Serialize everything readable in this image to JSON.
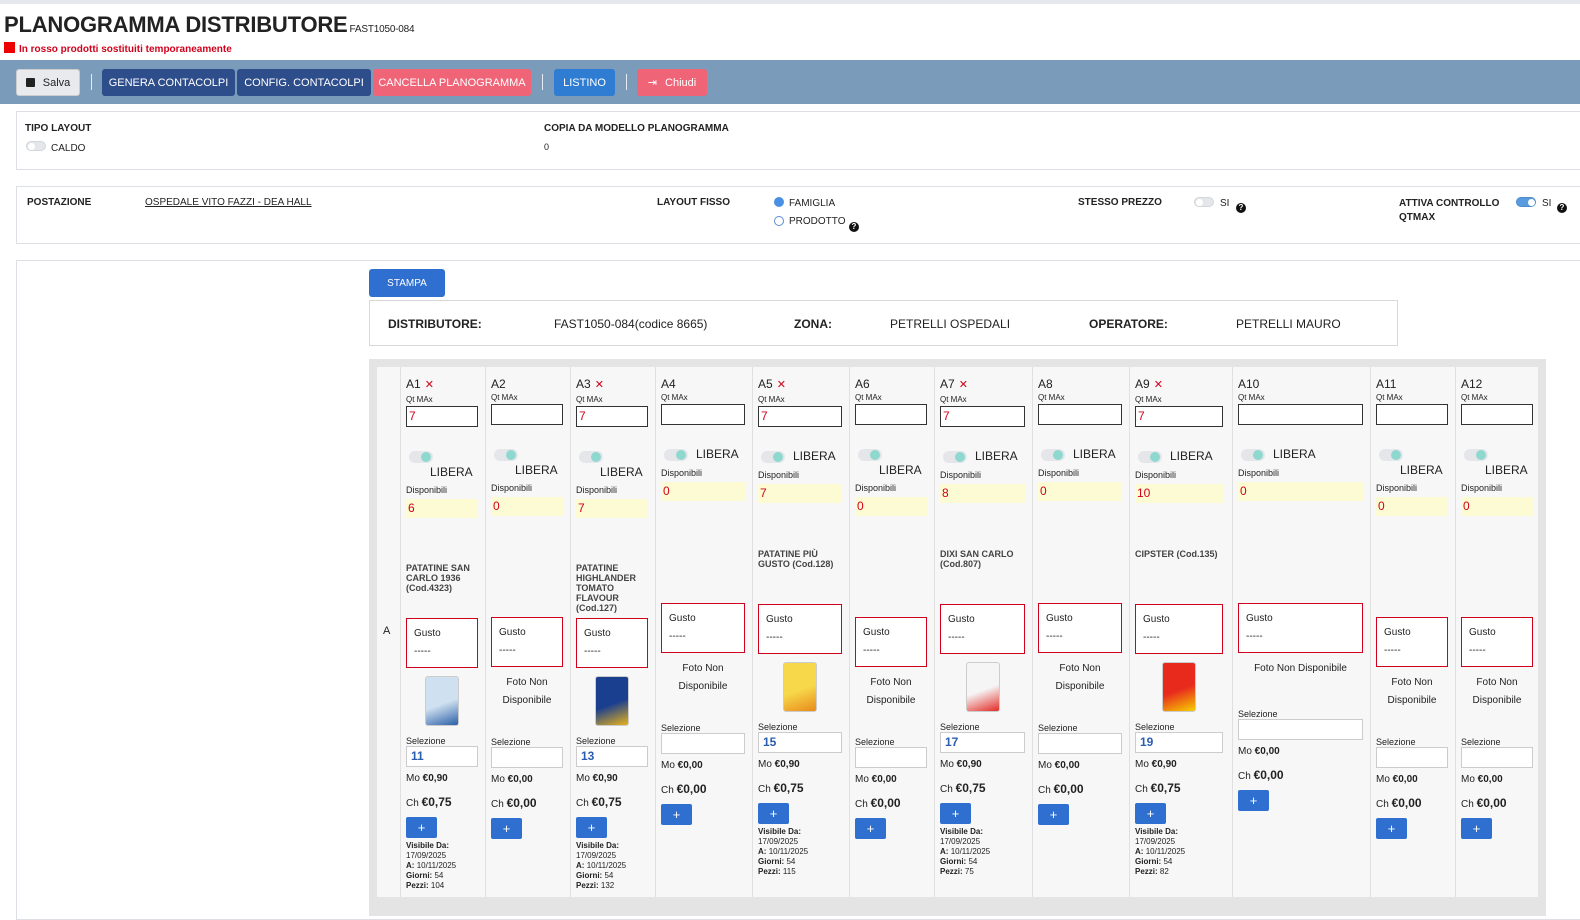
{
  "header": {
    "title": "PLANOGRAMMA DISTRIBUTORE",
    "code": "FAST1050-084",
    "note": "In rosso prodotti sostituiti temporaneamente"
  },
  "toolbar": {
    "save": "Salva",
    "genera": "GENERA CONTACOLPI",
    "config": "CONFIG. CONTACOLPI",
    "cancella": "CANCELLA PLANOGRAMMA",
    "listino": "LISTINO",
    "chiudi": "Chiudi"
  },
  "layout_panel": {
    "tipo_label": "TIPO LAYOUT",
    "tipo_value": "CALDO",
    "copia_label": "COPIA DA MODELLO PLANOGRAMMA",
    "copia_value": "0"
  },
  "settings": {
    "postazione_label": "POSTAZIONE",
    "postazione_value": "OSPEDALE VITO FAZZI - DEA HALL",
    "layout_fisso_label": "LAYOUT FISSO",
    "opt_famiglia": "FAMIGLIA",
    "opt_prodotto": "PRODOTTO",
    "stesso_prezzo_label": "STESSO PREZZO",
    "si": "SI",
    "attiva_label": "ATTIVA CONTROLLO QTMAX",
    "help": "?"
  },
  "stampa": "STAMPA",
  "info": {
    "distributore_label": "DISTRIBUTORE:",
    "distributore_value": "FAST1050-084(codice 8665)",
    "zona_label": "ZONA:",
    "zona_value": "PETRELLI OSPEDALI",
    "operatore_label": "OPERATORE:",
    "operatore_value": "PETRELLI MAURO"
  },
  "row_label": "A",
  "labels": {
    "qt": "Qt MAx",
    "libera": "LIBERA",
    "disp": "Disponibili",
    "gusto": "Gusto",
    "gusto_val": "-----",
    "foto": "Foto Non Disponibile",
    "foto1": "Foto Non",
    "foto2": "Disponibile",
    "sel": "Selezione",
    "mo_prefix": "Mo",
    "ch_prefix": "Ch",
    "plus": "+",
    "vis_da": "Visibile Da:",
    "vis_a": "A:",
    "giorni": "Giorni:",
    "pezzi": "Pezzi:"
  },
  "slots": [
    {
      "name": "A1",
      "x": true,
      "qt": "7",
      "disp": "6",
      "product": "PATATINE SAN CARLO 1936 (Cod.4323)",
      "image": "bag-1936",
      "sel": "11",
      "mo": "€0,90",
      "ch": "€0,75",
      "vis_da": "17/09/2025",
      "vis_a": "10/11/2025",
      "giorni": "54",
      "pezzi": "104"
    },
    {
      "name": "A2",
      "x": false,
      "qt": "",
      "disp": "0",
      "product": "",
      "image": "",
      "sel": "",
      "mo": "€0,00",
      "ch": "€0,00"
    },
    {
      "name": "A3",
      "x": true,
      "qt": "7",
      "disp": "7",
      "product": "PATATINE HIGHLANDER TOMATO FLAVOUR (Cod.127)",
      "image": "bag-highlander",
      "sel": "13",
      "mo": "€0,90",
      "ch": "€0,75",
      "vis_da": "17/09/2025",
      "vis_a": "10/11/2025",
      "giorni": "54",
      "pezzi": "132"
    },
    {
      "name": "A4",
      "x": false,
      "qt": "",
      "disp": "0",
      "product": "",
      "image": "",
      "sel": "",
      "mo": "€0,00",
      "ch": "€0,00"
    },
    {
      "name": "A5",
      "x": true,
      "qt": "7",
      "disp": "7",
      "product": "PATATINE PIÙ GUSTO (Cod.128)",
      "image": "bag-piu-gusto",
      "sel": "15",
      "mo": "€0,90",
      "ch": "€0,75",
      "vis_da": "17/09/2025",
      "vis_a": "10/11/2025",
      "giorni": "54",
      "pezzi": "115"
    },
    {
      "name": "A6",
      "x": false,
      "qt": "",
      "disp": "0",
      "product": "",
      "image": "",
      "sel": "",
      "mo": "€0,00",
      "ch": "€0,00"
    },
    {
      "name": "A7",
      "x": true,
      "qt": "7",
      "disp": "8",
      "product": "DIXI SAN CARLO (Cod.807)",
      "image": "bag-dixi",
      "sel": "17",
      "mo": "€0,90",
      "ch": "€0,75",
      "vis_da": "17/09/2025",
      "vis_a": "10/11/2025",
      "giorni": "54",
      "pezzi": "75"
    },
    {
      "name": "A8",
      "x": false,
      "qt": "",
      "disp": "0",
      "product": "",
      "image": "",
      "sel": "",
      "mo": "€0,00",
      "ch": "€0,00"
    },
    {
      "name": "A9",
      "x": true,
      "qt": "7",
      "disp": "10",
      "product": "CIPSTER (Cod.135)",
      "image": "bag-cipster",
      "sel": "19",
      "mo": "€0,90",
      "ch": "€0,75",
      "vis_da": "17/09/2025",
      "vis_a": "10/11/2025",
      "giorni": "54",
      "pezzi": "82"
    },
    {
      "name": "A10",
      "x": false,
      "qt": "",
      "disp": "0",
      "product": "",
      "image": "",
      "sel": "",
      "mo": "€0,00",
      "ch": "€0,00"
    },
    {
      "name": "A11",
      "x": false,
      "qt": "",
      "disp": "0",
      "product": "",
      "image": "",
      "sel": "",
      "mo": "€0,00",
      "ch": "€0,00"
    },
    {
      "name": "A12",
      "x": false,
      "qt": "",
      "disp": "0",
      "product": "",
      "image": "",
      "sel": "",
      "mo": "€0,00",
      "ch": "€0,00"
    }
  ]
}
